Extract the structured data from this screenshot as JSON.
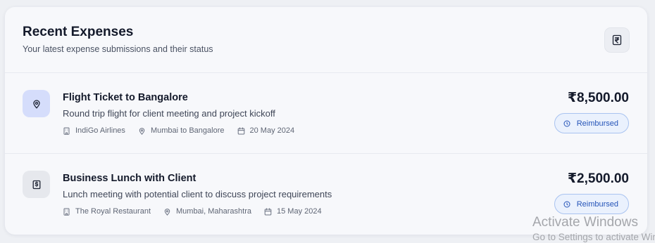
{
  "header": {
    "title": "Recent Expenses",
    "subtitle": "Your latest expense submissions and their status",
    "icon": "rupee-icon"
  },
  "expenses": [
    {
      "title": "Flight Ticket to Bangalore",
      "description": "Round trip flight for client meeting and project kickoff",
      "vendor": "IndiGo Airlines",
      "location": "Mumbai to Bangalore",
      "date": "20 May 2024",
      "amount": "₹8,500.00",
      "status": "Reimbursed",
      "icon": "map-pin-icon"
    },
    {
      "title": "Business Lunch with Client",
      "description": "Lunch meeting with potential client to discuss project requirements",
      "vendor": "The Royal Restaurant",
      "location": "Mumbai, Maharashtra",
      "date": "15 May 2024",
      "amount": "₹2,500.00",
      "status": "Reimbursed",
      "icon": "receipt-icon"
    }
  ],
  "watermark": {
    "title": "Activate Windows",
    "subtitle": "Go to Settings to activate Windows."
  },
  "colors": {
    "accent": "#2554b8",
    "badge_bg": "#eaf1fd",
    "badge_border": "#a9c3f0",
    "icon_blue_bg": "#d5ddfb"
  }
}
